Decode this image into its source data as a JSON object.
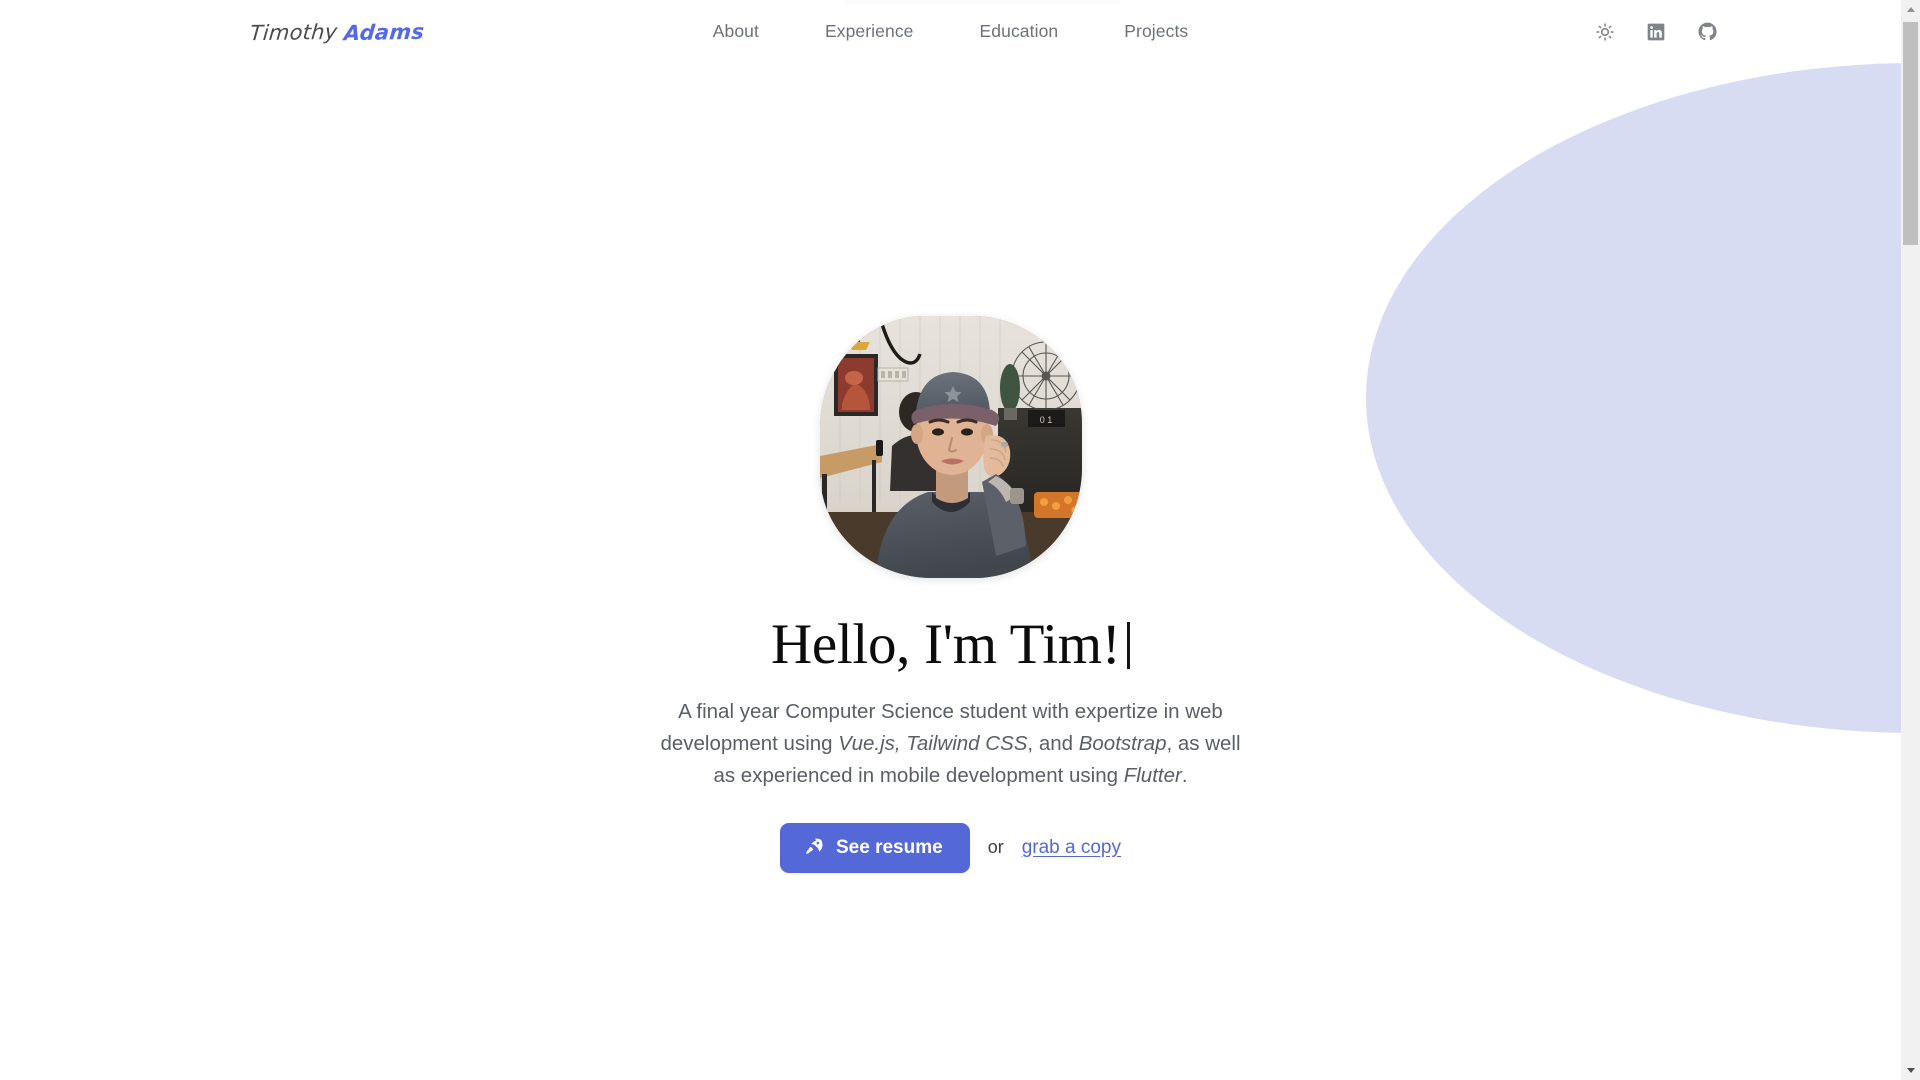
{
  "navbar": {
    "logo": {
      "first_name": "Timothy",
      "last_name": "Adams"
    },
    "links": [
      {
        "label": "About",
        "name": "nav-link-about"
      },
      {
        "label": "Experience",
        "name": "nav-link-experience"
      },
      {
        "label": "Education",
        "name": "nav-link-education"
      },
      {
        "label": "Projects",
        "name": "nav-link-projects"
      }
    ],
    "icons": [
      {
        "name": "sun-icon",
        "title": "Toggle theme"
      },
      {
        "name": "linkedin-icon",
        "title": "LinkedIn"
      },
      {
        "name": "github-icon",
        "title": "GitHub"
      }
    ]
  },
  "hero": {
    "avatar_alt": "Profile photo of Tim seated in a cafe wearing a cap",
    "title": "Hello, I'm Tim!",
    "caret": "|",
    "description": {
      "part1": "A final year Computer Science student with expertize in web development using ",
      "tech1": "Vue.js, Tailwind CSS",
      "part2": ", and ",
      "tech2": "Bootstrap",
      "part3": ", as well as experienced in mobile development using ",
      "tech3": "Flutter",
      "part4": "."
    },
    "cta": {
      "primary_label": "See resume",
      "primary_icon": "rocket-icon",
      "separator": "or",
      "link_label": "grab a copy"
    }
  },
  "theme": {
    "accent": "#5468d8",
    "blob": "#d8dcf3",
    "text_muted": "#5a5f66",
    "nav_text": "#6e7277",
    "background": "#ffffff"
  },
  "scrollbar": {
    "up_arrow": "▲",
    "down_arrow": "▼"
  }
}
